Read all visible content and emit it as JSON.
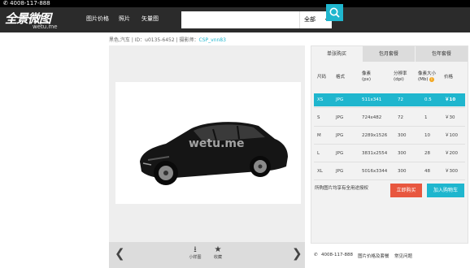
{
  "topbar": {
    "phone": "4008-117-888"
  },
  "header": {
    "logo": "全景微图",
    "logo_sub": "wetu.me",
    "nav": [
      "图片价格",
      "照片",
      "矢量图"
    ],
    "search": {
      "placeholder": "",
      "category": "全部"
    }
  },
  "meta": {
    "keywords": "黑色,汽车",
    "id_text": "ID：u0135-6452",
    "photographer_label": "摄影师：",
    "photographer": "CSP_vnn83"
  },
  "image": {
    "watermark": "wetu.me"
  },
  "toolbar": {
    "download_label": "小样图",
    "favorite_label": "收藏"
  },
  "colors": {
    "accent": "#1fb6ce",
    "buy": "#e8573f",
    "header": "#2b2b2b"
  },
  "pricing": {
    "tabs": [
      "单张购买",
      "包月套餐",
      "包年套餐"
    ],
    "headers": {
      "size": "尺码",
      "format": "格式",
      "pixels": "像素\n(px)",
      "resolution": "分辨率\n(dpi)",
      "filesize": "像素大小\n(Mb)",
      "price": "价格"
    },
    "rows": [
      {
        "size": "XS",
        "format": "JPG",
        "pixels": "511x341",
        "dpi": "72",
        "mb": "0.5",
        "price": "￥10",
        "selected": true
      },
      {
        "size": "S",
        "format": "JPG",
        "pixels": "724x482",
        "dpi": "72",
        "mb": "1",
        "price": "￥30"
      },
      {
        "size": "M",
        "format": "JPG",
        "pixels": "2289x1526",
        "dpi": "300",
        "mb": "10",
        "price": "￥100"
      },
      {
        "size": "L",
        "format": "JPG",
        "pixels": "3831x2554",
        "dpi": "300",
        "mb": "28",
        "price": "￥200"
      },
      {
        "size": "XL",
        "format": "JPG",
        "pixels": "5016x3344",
        "dpi": "300",
        "mb": "48",
        "price": "￥300"
      }
    ],
    "note": "所购图片均享有全用途授权",
    "buy_label": "立即购买",
    "cart_label": "加入购物车"
  },
  "footer": {
    "phone": "4008-117-888",
    "link1": "图片价格及套餐",
    "link2": "常见问题"
  }
}
